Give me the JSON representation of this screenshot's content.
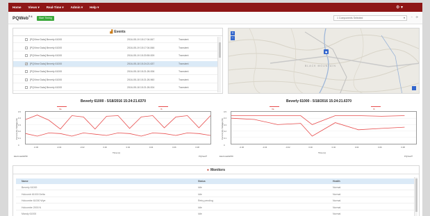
{
  "nav": {
    "items": [
      "Home",
      "Views ▾",
      "Real-Time ▾",
      "Admin ▾",
      "Help ▾"
    ],
    "settings_label": "⚙ ▾"
  },
  "header": {
    "brand": "PQWeb",
    "brand_version": "® 4",
    "start_timer": "Start Timing",
    "component_select": "1 Components Selected"
  },
  "events": {
    "title": "Events",
    "rows": [
      {
        "name": "[PQView Data] Beverly 61000",
        "date": "2016-05-19 15:17:04.847",
        "type": "Transient",
        "checked": false,
        "selected": false
      },
      {
        "name": "[PQView Data] Beverly 61000",
        "date": "2016-05-19 15:17:04.846",
        "type": "Transient",
        "checked": false,
        "selected": false
      },
      {
        "name": "[PQView Data] Beverly 61000",
        "date": "2016-05-19 15:20:59.009",
        "type": "Transient",
        "checked": false,
        "selected": false
      },
      {
        "name": "[PQView Data] Beverly 61000",
        "date": "2016-05-18 15:24:21.637",
        "type": "Transient",
        "checked": true,
        "selected": true
      },
      {
        "name": "[PQView Data] Beverly 61000",
        "date": "2016-05-18 15:21:26.006",
        "type": "Transient",
        "checked": false,
        "selected": false
      },
      {
        "name": "[PQView Data] Beverly 61000",
        "date": "2016-05-18 15:21:26.960",
        "type": "Transient",
        "checked": false,
        "selected": false
      },
      {
        "name": "[PQView Data] Beverly 61000",
        "date": "2016-05-18 15:21:26.004",
        "type": "Transient",
        "checked": false,
        "selected": false
      }
    ]
  },
  "map": {
    "zoom_in": "+",
    "zoom_out": "−",
    "label": "BLACK MOUNTAIN"
  },
  "chart_data": [
    {
      "type": "line",
      "title": "Beverly 61000 - 5/18/2016 15:24:21.6370",
      "xlabel": "Time (s)",
      "ylabel": "Current (A) / Voltage (%)",
      "x_ticks": [
        "-0.06",
        "-0.04",
        "-0.02",
        "0.00",
        "0.02",
        "0.04",
        "0.06",
        "0.08"
      ],
      "y_ticks": [
        "0.5",
        "0.4",
        "0.3",
        "0.2",
        "0.1",
        "0"
      ],
      "legend": [
        "Va",
        "Ib"
      ],
      "footnote_left": "Electrotek/EPRI",
      "footnote_right": "PQView®",
      "series": [
        {
          "x": [
            -0.07,
            -0.06,
            -0.05,
            -0.04,
            -0.03,
            -0.02,
            -0.01,
            0.0,
            0.01,
            0.02,
            0.03,
            0.04,
            0.05,
            0.06,
            0.07,
            0.08,
            0.09
          ],
          "values": [
            0.38,
            0.45,
            0.37,
            0.23,
            0.44,
            0.42,
            0.23,
            0.43,
            0.44,
            0.24,
            0.42,
            0.44,
            0.25,
            0.42,
            0.44,
            0.25,
            0.44
          ]
        },
        {
          "x": [
            -0.07,
            -0.06,
            -0.05,
            -0.04,
            -0.03,
            -0.02,
            -0.01,
            0.0,
            0.01,
            0.02,
            0.03,
            0.04,
            0.05,
            0.06,
            0.07,
            0.08,
            0.09
          ],
          "values": [
            0.16,
            0.12,
            0.17,
            0.16,
            0.12,
            0.17,
            0.15,
            0.13,
            0.17,
            0.16,
            0.12,
            0.17,
            0.16,
            0.13,
            0.17,
            0.16,
            0.13
          ]
        }
      ],
      "ylim": [
        0,
        0.5
      ]
    },
    {
      "type": "line",
      "title": "Beverly 61000 - 5/18/2016 15:24:21.6370",
      "xlabel": "Time (s)",
      "ylabel": "Current (A) / Voltage (%)",
      "x_ticks": [
        "-0.06",
        "-0.04",
        "-0.02",
        "0.00",
        "0.02",
        "0.04",
        "0.06",
        "0.08"
      ],
      "y_ticks": [
        "0.5",
        "0.4",
        "0.3",
        "0.2",
        "0.1",
        "0"
      ],
      "legend": [
        "Va",
        "Ib"
      ],
      "footnote_left": "Electrotek/EPRI",
      "footnote_right": "PQView®",
      "series": [
        {
          "x": [
            -0.07,
            -0.05,
            -0.03,
            -0.01,
            0.0,
            0.02,
            0.04,
            0.06,
            0.08
          ],
          "values": [
            0.44,
            0.44,
            0.44,
            0.44,
            0.3,
            0.44,
            0.44,
            0.43,
            0.44
          ]
        },
        {
          "x": [
            -0.07,
            -0.05,
            -0.03,
            -0.01,
            0.0,
            0.02,
            0.04,
            0.06,
            0.08
          ],
          "values": [
            0.4,
            0.38,
            0.3,
            0.32,
            0.12,
            0.33,
            0.22,
            0.24,
            0.26
          ]
        }
      ],
      "ylim": [
        0,
        0.5
      ]
    }
  ],
  "monitors": {
    "title": "Monitors",
    "columns": [
      "Name",
      "Status",
      "Health"
    ],
    "rows": [
      {
        "name": "Beverly 61000",
        "status": "Idle",
        "health": "Normal"
      },
      {
        "name": "Holcomb 61000 Delta",
        "status": "Idle",
        "health": "Normal"
      },
      {
        "name": "Holcombe 61000 Wye",
        "status": "Retry pending",
        "health": "Normal"
      },
      {
        "name": "Holcombe 2000 N",
        "status": "Idle",
        "health": "Normal"
      },
      {
        "name": "Mandy 61000",
        "status": "Idle",
        "health": "Normal"
      }
    ]
  },
  "colors": {
    "nav_bg": "#8e1616",
    "accent_green": "#3aa83a",
    "selection_blue": "#dbeaf7",
    "series_red": "#e74c4c"
  }
}
